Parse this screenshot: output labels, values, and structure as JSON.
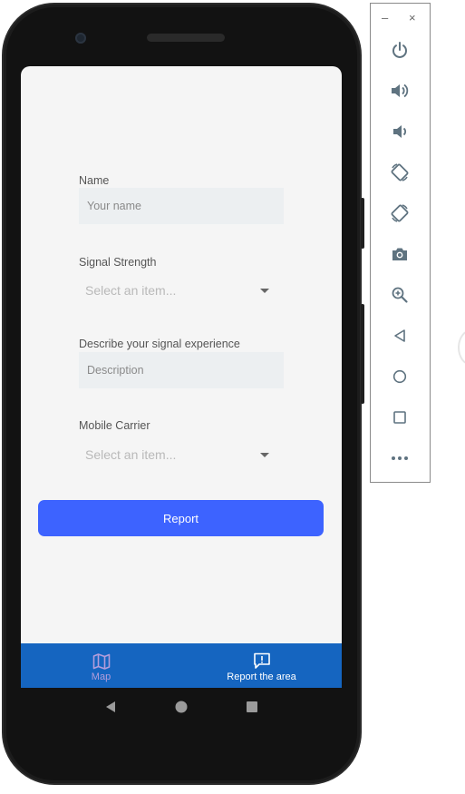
{
  "form": {
    "name_label": "Name",
    "name_placeholder": "Your name",
    "signal_label": "Signal Strength",
    "signal_select": "Select an item...",
    "description_label": "Describe your signal experience",
    "description_placeholder": "Description",
    "carrier_label": "Mobile Carrier",
    "carrier_select": "Select an item...",
    "report_button": "Report"
  },
  "bottom_nav": {
    "items": [
      {
        "label": "Map",
        "icon": "map-icon"
      },
      {
        "label": "Report the area",
        "icon": "report-icon"
      }
    ]
  },
  "system_nav": [
    "back-icon",
    "home-icon",
    "recents-icon"
  ],
  "emulator_toolbar": {
    "window_controls": [
      "–",
      "×"
    ],
    "buttons": [
      "power-icon",
      "volume-up-icon",
      "volume-down-icon",
      "rotate-left-icon",
      "rotate-right-icon",
      "camera-icon",
      "zoom-icon",
      "back-icon",
      "home-icon",
      "overview-icon",
      "more-icon"
    ]
  },
  "colors": {
    "accent": "#3d63ff",
    "nav_bar": "#1565c0",
    "nav_active": "#b39ddb",
    "icon": "#5f7380"
  }
}
